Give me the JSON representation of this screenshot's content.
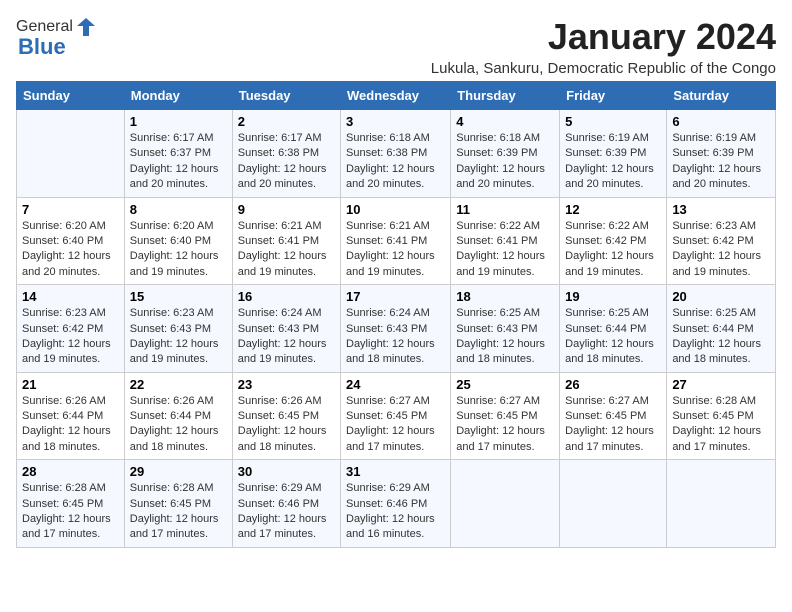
{
  "logo": {
    "general": "General",
    "blue": "Blue"
  },
  "header": {
    "title": "January 2024",
    "subtitle": "Lukula, Sankuru, Democratic Republic of the Congo"
  },
  "columns": [
    "Sunday",
    "Monday",
    "Tuesday",
    "Wednesday",
    "Thursday",
    "Friday",
    "Saturday"
  ],
  "weeks": [
    [
      {
        "day": "",
        "info": ""
      },
      {
        "day": "1",
        "info": "Sunrise: 6:17 AM\nSunset: 6:37 PM\nDaylight: 12 hours and 20 minutes."
      },
      {
        "day": "2",
        "info": "Sunrise: 6:17 AM\nSunset: 6:38 PM\nDaylight: 12 hours and 20 minutes."
      },
      {
        "day": "3",
        "info": "Sunrise: 6:18 AM\nSunset: 6:38 PM\nDaylight: 12 hours and 20 minutes."
      },
      {
        "day": "4",
        "info": "Sunrise: 6:18 AM\nSunset: 6:39 PM\nDaylight: 12 hours and 20 minutes."
      },
      {
        "day": "5",
        "info": "Sunrise: 6:19 AM\nSunset: 6:39 PM\nDaylight: 12 hours and 20 minutes."
      },
      {
        "day": "6",
        "info": "Sunrise: 6:19 AM\nSunset: 6:39 PM\nDaylight: 12 hours and 20 minutes."
      }
    ],
    [
      {
        "day": "7",
        "info": "Sunrise: 6:20 AM\nSunset: 6:40 PM\nDaylight: 12 hours and 20 minutes."
      },
      {
        "day": "8",
        "info": "Sunrise: 6:20 AM\nSunset: 6:40 PM\nDaylight: 12 hours and 19 minutes."
      },
      {
        "day": "9",
        "info": "Sunrise: 6:21 AM\nSunset: 6:41 PM\nDaylight: 12 hours and 19 minutes."
      },
      {
        "day": "10",
        "info": "Sunrise: 6:21 AM\nSunset: 6:41 PM\nDaylight: 12 hours and 19 minutes."
      },
      {
        "day": "11",
        "info": "Sunrise: 6:22 AM\nSunset: 6:41 PM\nDaylight: 12 hours and 19 minutes."
      },
      {
        "day": "12",
        "info": "Sunrise: 6:22 AM\nSunset: 6:42 PM\nDaylight: 12 hours and 19 minutes."
      },
      {
        "day": "13",
        "info": "Sunrise: 6:23 AM\nSunset: 6:42 PM\nDaylight: 12 hours and 19 minutes."
      }
    ],
    [
      {
        "day": "14",
        "info": "Sunrise: 6:23 AM\nSunset: 6:42 PM\nDaylight: 12 hours and 19 minutes."
      },
      {
        "day": "15",
        "info": "Sunrise: 6:23 AM\nSunset: 6:43 PM\nDaylight: 12 hours and 19 minutes."
      },
      {
        "day": "16",
        "info": "Sunrise: 6:24 AM\nSunset: 6:43 PM\nDaylight: 12 hours and 19 minutes."
      },
      {
        "day": "17",
        "info": "Sunrise: 6:24 AM\nSunset: 6:43 PM\nDaylight: 12 hours and 18 minutes."
      },
      {
        "day": "18",
        "info": "Sunrise: 6:25 AM\nSunset: 6:43 PM\nDaylight: 12 hours and 18 minutes."
      },
      {
        "day": "19",
        "info": "Sunrise: 6:25 AM\nSunset: 6:44 PM\nDaylight: 12 hours and 18 minutes."
      },
      {
        "day": "20",
        "info": "Sunrise: 6:25 AM\nSunset: 6:44 PM\nDaylight: 12 hours and 18 minutes."
      }
    ],
    [
      {
        "day": "21",
        "info": "Sunrise: 6:26 AM\nSunset: 6:44 PM\nDaylight: 12 hours and 18 minutes."
      },
      {
        "day": "22",
        "info": "Sunrise: 6:26 AM\nSunset: 6:44 PM\nDaylight: 12 hours and 18 minutes."
      },
      {
        "day": "23",
        "info": "Sunrise: 6:26 AM\nSunset: 6:45 PM\nDaylight: 12 hours and 18 minutes."
      },
      {
        "day": "24",
        "info": "Sunrise: 6:27 AM\nSunset: 6:45 PM\nDaylight: 12 hours and 17 minutes."
      },
      {
        "day": "25",
        "info": "Sunrise: 6:27 AM\nSunset: 6:45 PM\nDaylight: 12 hours and 17 minutes."
      },
      {
        "day": "26",
        "info": "Sunrise: 6:27 AM\nSunset: 6:45 PM\nDaylight: 12 hours and 17 minutes."
      },
      {
        "day": "27",
        "info": "Sunrise: 6:28 AM\nSunset: 6:45 PM\nDaylight: 12 hours and 17 minutes."
      }
    ],
    [
      {
        "day": "28",
        "info": "Sunrise: 6:28 AM\nSunset: 6:45 PM\nDaylight: 12 hours and 17 minutes."
      },
      {
        "day": "29",
        "info": "Sunrise: 6:28 AM\nSunset: 6:45 PM\nDaylight: 12 hours and 17 minutes."
      },
      {
        "day": "30",
        "info": "Sunrise: 6:29 AM\nSunset: 6:46 PM\nDaylight: 12 hours and 17 minutes."
      },
      {
        "day": "31",
        "info": "Sunrise: 6:29 AM\nSunset: 6:46 PM\nDaylight: 12 hours and 16 minutes."
      },
      {
        "day": "",
        "info": ""
      },
      {
        "day": "",
        "info": ""
      },
      {
        "day": "",
        "info": ""
      }
    ]
  ]
}
